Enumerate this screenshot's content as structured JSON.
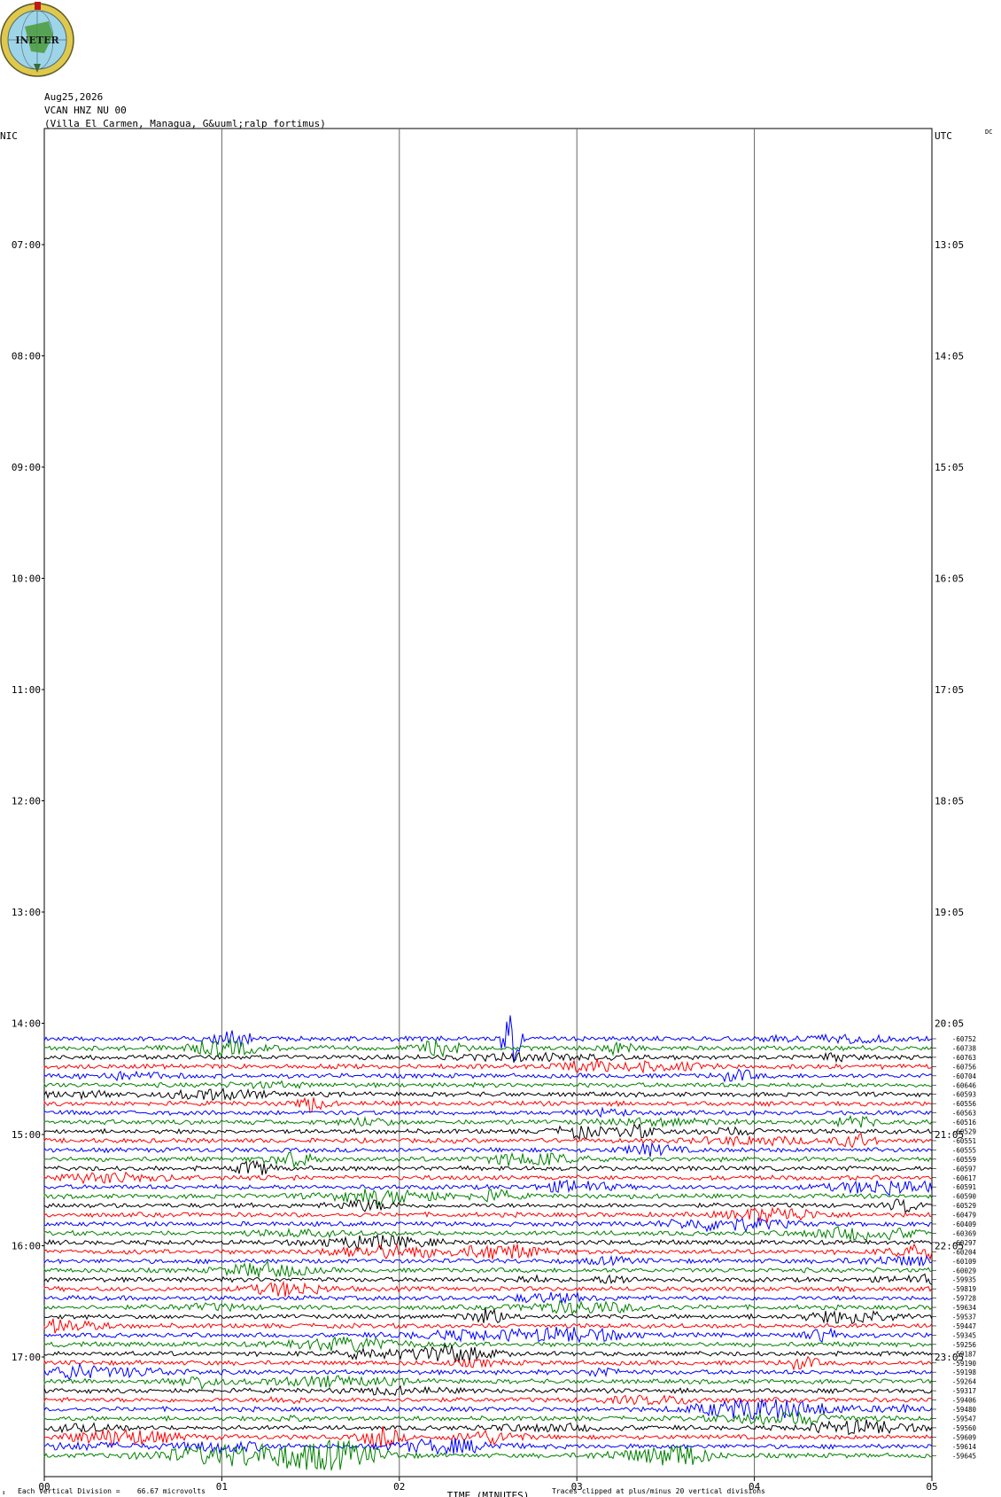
{
  "logo": {
    "text": "INETER"
  },
  "header": {
    "date": "Aug25,2026",
    "channel": "VCAN HNZ NU 00",
    "station": "(Villa El Carmen, Managua, G&uuml;ralp fortimus)",
    "left_tz": "NIC",
    "right_tz": "UTC",
    "dc_label": "DC"
  },
  "footer": {
    "x_axis_title": "TIME (MINUTES)",
    "vertical_division": "Each Vertical Division =    66.67 microvolts",
    "clip_note": "Traces clipped at plus/minus 20 vertical divisions"
  },
  "chart_data": {
    "type": "line",
    "title": "",
    "xlabel": "TIME (MINUTES)",
    "x_ticks": [
      "00",
      "01",
      "02",
      "03",
      "04",
      "05"
    ],
    "xlim": [
      0,
      5
    ],
    "grid": "vertical lines at each minute",
    "left_hour_labels": [
      "07:00",
      "08:00",
      "09:00",
      "10:00",
      "11:00",
      "12:00",
      "13:00",
      "14:00",
      "15:00",
      "16:00",
      "17:00"
    ],
    "right_hour_labels": [
      "13:05",
      "14:05",
      "15:05",
      "16:05",
      "17:05",
      "18:05",
      "19:05",
      "20:05",
      "21:05",
      "22:05",
      "23:05"
    ],
    "trace_colors": [
      "#0000ff",
      "#008000",
      "#000000",
      "#ff0000"
    ],
    "trace_offsets": [
      "-60752",
      "-60738",
      "-60763",
      "-60756",
      "-60704",
      "-60646",
      "-60593",
      "-60556",
      "-60563",
      "-60516",
      "-60529",
      "-60551",
      "-60555",
      "-60559",
      "-60597",
      "-60617",
      "-60591",
      "-60590",
      "-60529",
      "-60479",
      "-60409",
      "-60369",
      "-60297",
      "-60204",
      "-60109",
      "-60029",
      "-59935",
      "-59819",
      "-59728",
      "-59634",
      "-59537",
      "-59447",
      "-59345",
      "-59256",
      "-59187",
      "-59190",
      "-59198",
      "-59264",
      "-59317",
      "-59406",
      "-59480",
      "-59547",
      "-59560",
      "-59609",
      "-59614",
      "-59645"
    ]
  }
}
